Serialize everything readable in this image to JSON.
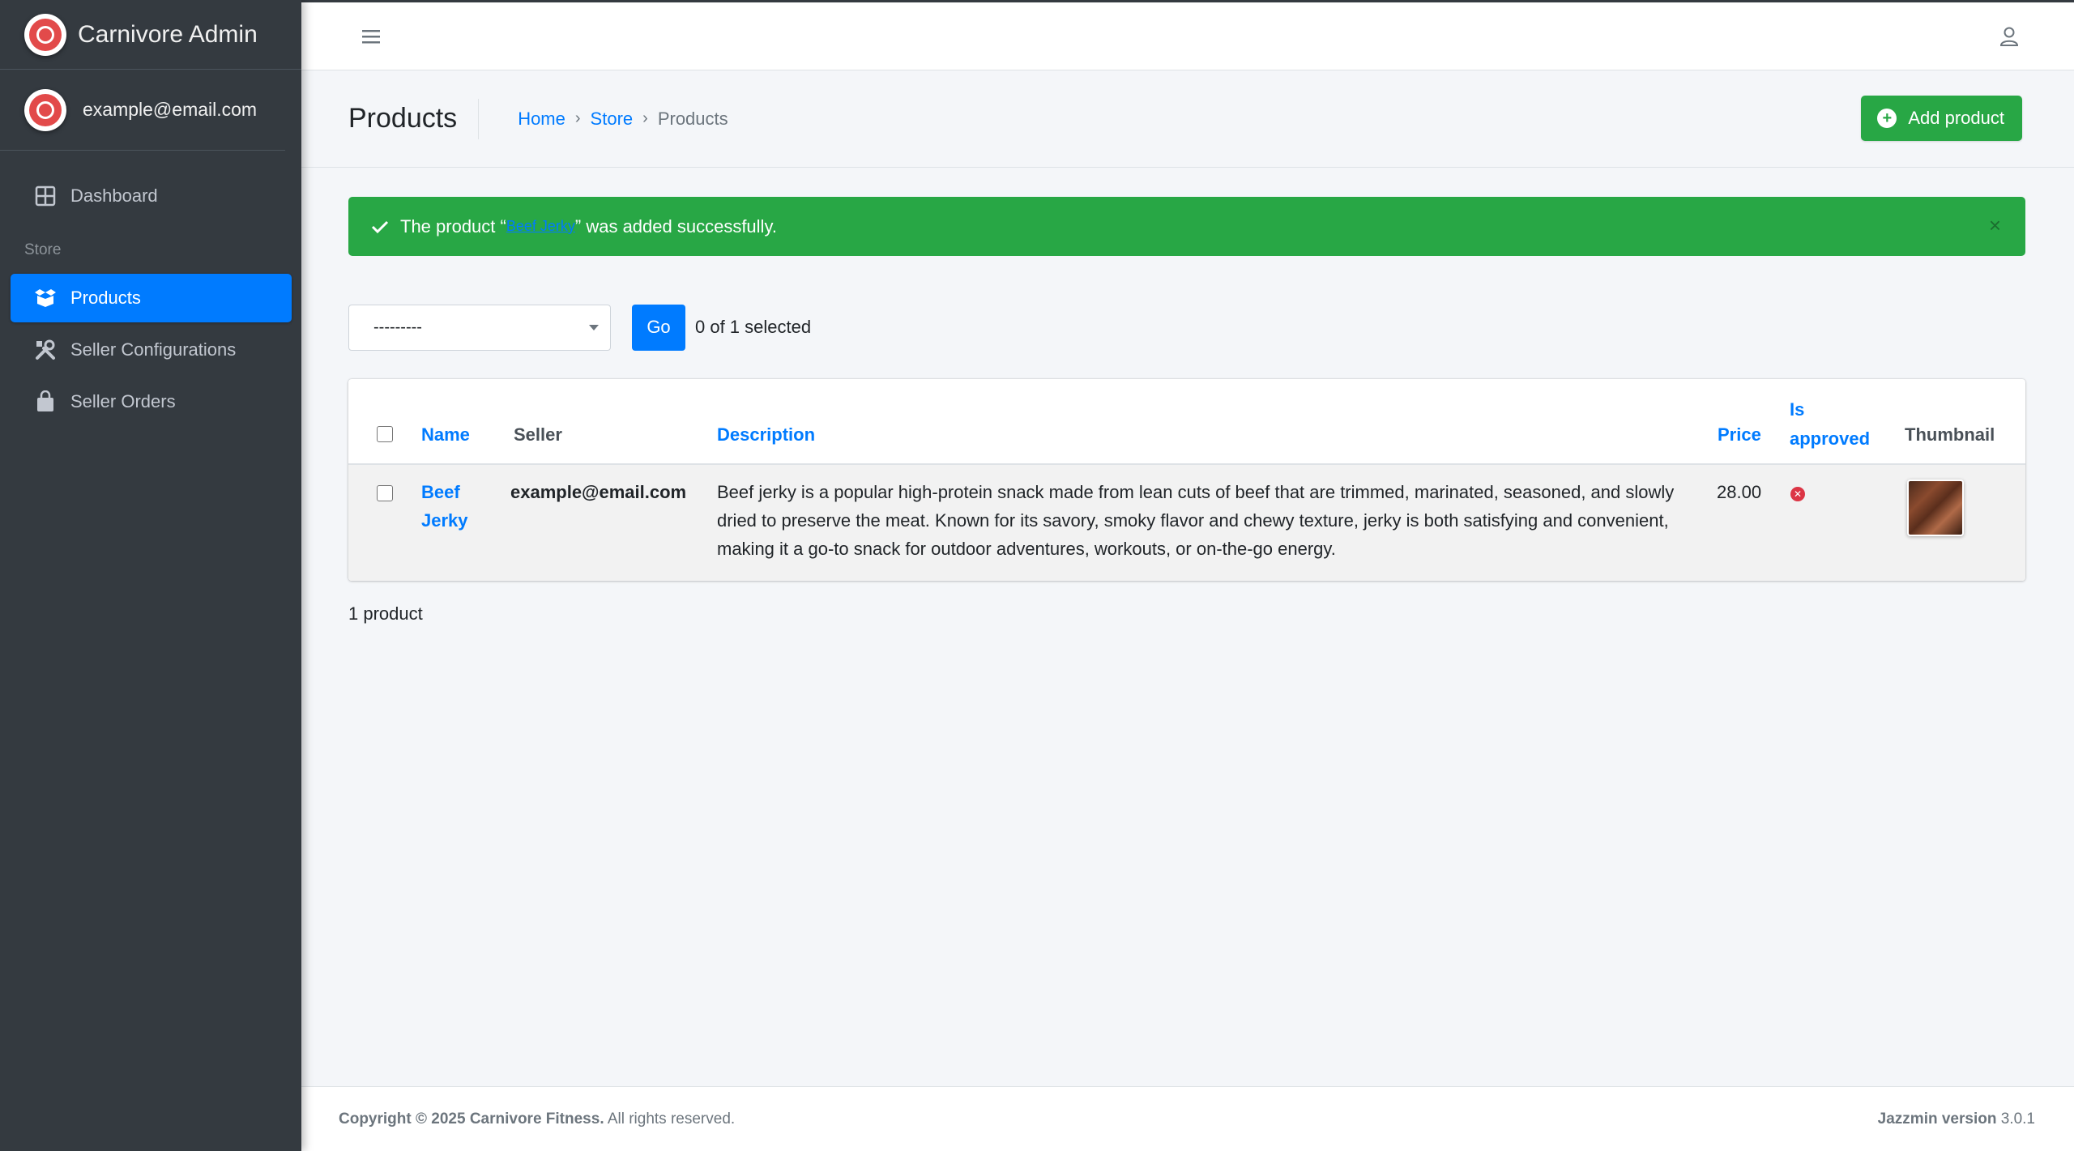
{
  "brand": {
    "title": "Carnivore Admin"
  },
  "user": {
    "email": "example@email.com"
  },
  "sidebar": {
    "items": [
      {
        "label": "Dashboard",
        "icon": "dashboard-icon"
      },
      {
        "section_header": "Store"
      },
      {
        "label": "Products",
        "icon": "box-icon",
        "active": true
      },
      {
        "label": "Seller Configurations",
        "icon": "tools-icon"
      },
      {
        "label": "Seller Orders",
        "icon": "shopping-bag-icon"
      }
    ]
  },
  "header": {
    "title": "Products",
    "breadcrumb": [
      "Home",
      "Store",
      "Products"
    ],
    "add_button": "Add product"
  },
  "alert": {
    "prefix": "The product “",
    "link": "Beef Jerky",
    "suffix": "” was added successfully.",
    "close": "×"
  },
  "actions": {
    "select_value": "---------",
    "go_label": "Go",
    "selected_text": "0 of 1 selected"
  },
  "table": {
    "columns": [
      "Name",
      "Seller",
      "Description",
      "Price",
      "Is approved",
      "Thumbnail"
    ],
    "rows": [
      {
        "name": "Beef Jerky",
        "seller": "example@email.com",
        "description": "Beef jerky is a popular high-protein snack made from lean cuts of beef that are trimmed, marinated, seasoned, and slowly dried to preserve the meat. Known for its savory, smoky flavor and chewy texture, jerky is both satisfying and convenient, making it a go-to snack for outdoor adventures, workouts, or on-the-go energy.",
        "price": "28.00",
        "is_approved": false
      }
    ]
  },
  "result_count": "1 product",
  "footer": {
    "copyright_bold": "Copyright © 2025 Carnivore Fitness.",
    "copyright_rest": " All rights reserved.",
    "version_bold": "Jazzmin version",
    "version": " 3.0.1"
  },
  "colors": {
    "sidebar_bg": "#343a40",
    "primary": "#007bff",
    "success": "#28a745",
    "danger": "#dc3545"
  }
}
